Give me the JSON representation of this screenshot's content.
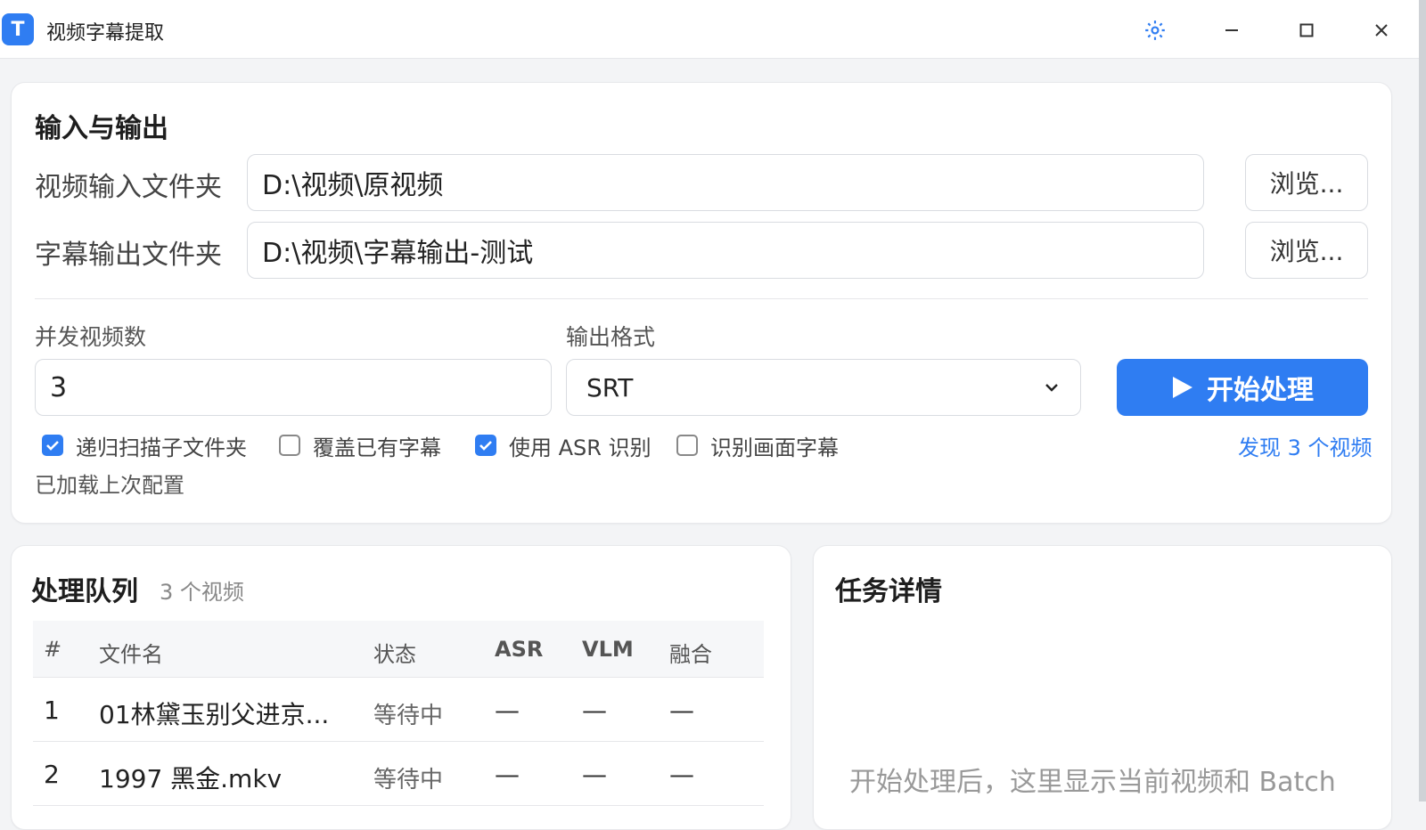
{
  "window": {
    "title": "视频字幕提取",
    "app_icon_letter": "T"
  },
  "io": {
    "section_title": "输入与输出",
    "video_input_label": "视频输入文件夹",
    "video_input_value": "D:\\视频\\原视频",
    "subtitle_output_label": "字幕输出文件夹",
    "subtitle_output_value": "D:\\视频\\字幕输出-测试",
    "browse_label": "浏览...",
    "concurrency_label": "并发视频数",
    "concurrency_value": "3",
    "format_label": "输出格式",
    "format_value": "SRT",
    "start_label": "开始处理",
    "options": [
      {
        "label": "递归扫描子文件夹",
        "checked": true
      },
      {
        "label": "覆盖已有字幕",
        "checked": false
      },
      {
        "label": "使用 ASR 识别",
        "checked": true
      },
      {
        "label": "识别画面字幕",
        "checked": false
      }
    ],
    "found_text": "发现 3 个视频",
    "loaded_text": "已加载上次配置"
  },
  "queue": {
    "title": "处理队列",
    "count": "3 个视频",
    "columns": [
      "#",
      "文件名",
      "状态",
      "ASR",
      "VLM",
      "融合"
    ],
    "rows": [
      {
        "index": "1",
        "file": "01林黛玉别父进京...",
        "status": "等待中",
        "asr": "—",
        "vlm": "—",
        "merge": "—"
      },
      {
        "index": "2",
        "file": "1997 黑金.mkv",
        "status": "等待中",
        "asr": "—",
        "vlm": "—",
        "merge": "—"
      }
    ]
  },
  "detail": {
    "title": "任务详情",
    "hint": "开始处理后，这里显示当前视频和 Batch"
  },
  "colors": {
    "accent": "#2f7df2"
  }
}
